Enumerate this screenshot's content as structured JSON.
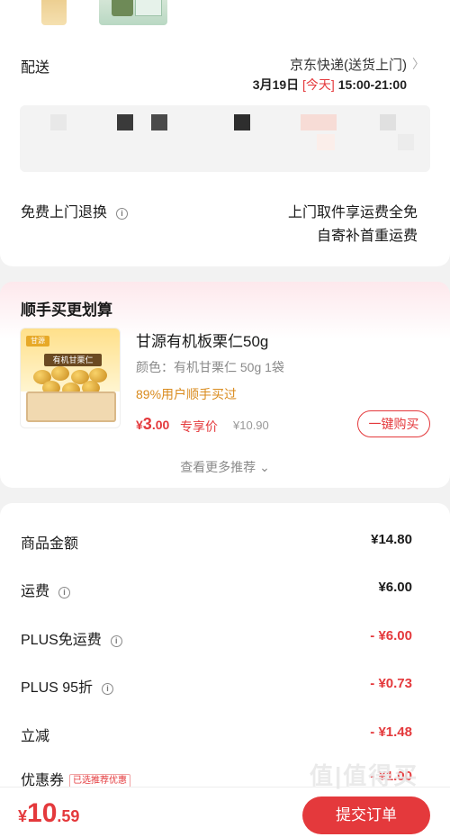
{
  "delivery": {
    "label": "配送",
    "method": "京东快递(送货上门)",
    "time_date": "3月19日",
    "time_today": "[今天]",
    "time_range": "15:00-21:00"
  },
  "return_service": {
    "label": "免费上门退换",
    "line1": "上门取件享运费全免",
    "line2": "自寄补首重运费"
  },
  "recommend": {
    "title": "顺手买更划算",
    "product_name": "甘源有机板栗仁50g",
    "spec": "颜色：有机甘栗仁 50g 1袋",
    "stat": "89%用户顺手买过",
    "price_currency": "¥",
    "price_int": "3",
    "price_dec": ".00",
    "price_tag": "专享价",
    "original_price": "¥10.90",
    "buy_button": "一键购买",
    "more_link": "查看更多推荐",
    "image_brand": "甘源",
    "image_label": "有机甘栗仁"
  },
  "fees": [
    {
      "label": "商品金额",
      "value": "¥14.80",
      "info": false
    },
    {
      "label": "运费",
      "value": "¥6.00",
      "info": true
    },
    {
      "label": "PLUS免运费",
      "value": "- ¥6.00",
      "info": true
    },
    {
      "label": "PLUS 95折",
      "value": "- ¥0.73",
      "info": true
    },
    {
      "label": "立减",
      "value": "- ¥1.48",
      "info": false
    },
    {
      "label": "优惠券",
      "value": "- ¥1.00",
      "tag": "已选推荐优惠"
    }
  ],
  "bottom": {
    "currency": "¥",
    "total_int": "10",
    "total_dec": ".59",
    "submit": "提交订单"
  },
  "watermark": "值|值得买",
  "colors": {
    "accent": "#e4393c",
    "orange": "#d98a1c"
  }
}
